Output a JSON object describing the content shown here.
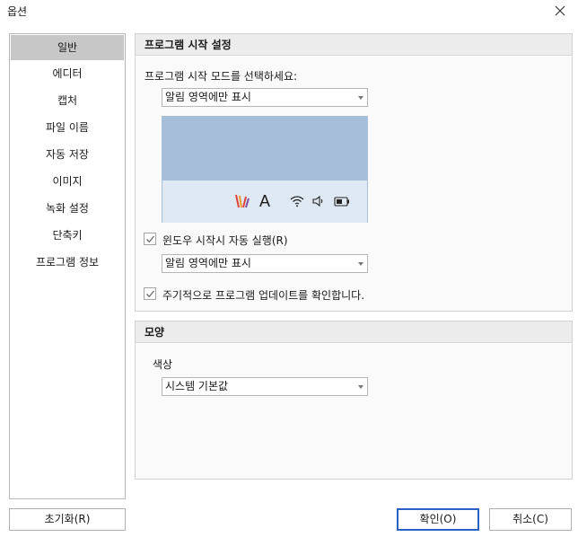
{
  "window": {
    "title": "옵션"
  },
  "sidebar": {
    "items": [
      {
        "label": "일반",
        "selected": true
      },
      {
        "label": "에디터"
      },
      {
        "label": "캡처"
      },
      {
        "label": "파일 이름"
      },
      {
        "label": "자동 저장"
      },
      {
        "label": "이미지"
      },
      {
        "label": "녹화 설정"
      },
      {
        "label": "단축키"
      },
      {
        "label": "프로그램 정보"
      }
    ],
    "reset_button": "초기화(R)"
  },
  "startup": {
    "header": "프로그램 시작 설정",
    "mode_label": "프로그램 시작 모드를 선택하세요:",
    "mode_value": "알림 영역에만 표시",
    "windows_start_checkbox": {
      "label": "윈도우 시작시 자동 실행(R)",
      "checked": true
    },
    "windows_start_mode_value": "알림 영역에만 표시",
    "update_checkbox": {
      "label": "주기적으로 프로그램 업데이트를 확인합니다.",
      "checked": true
    },
    "tray_icons": [
      "app-logo-icon",
      "input-language-icon",
      "wifi-icon",
      "volume-icon",
      "battery-icon"
    ],
    "tray_letter": "A"
  },
  "appearance": {
    "header": "모양",
    "color_label": "색상",
    "color_value": "시스템 기본값"
  },
  "footer": {
    "ok_button": "확인(O)",
    "cancel_button": "취소(C)"
  },
  "colors": {
    "preview_top": "#a6bed9",
    "preview_bottom": "#dfe9f4",
    "selected_item": "#c7c7c7",
    "ok_border": "#2a62c4"
  }
}
